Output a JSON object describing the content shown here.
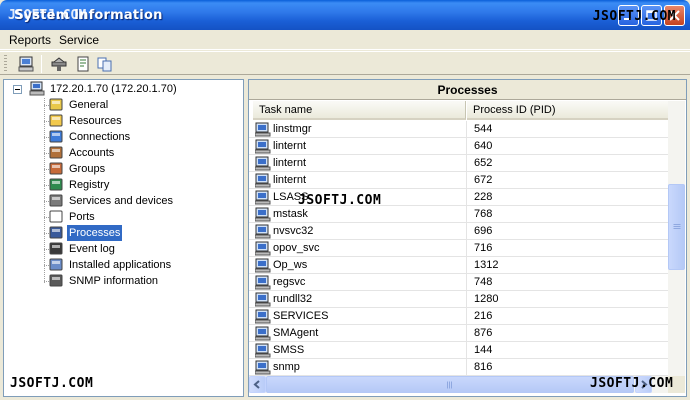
{
  "window": {
    "title": "System Information",
    "title_overlay": "JSOFTJ.COM",
    "watermark": "JSOFTJ.COM"
  },
  "menu": {
    "items": [
      {
        "label": "Reports"
      },
      {
        "label": "Service"
      }
    ]
  },
  "toolbar": {
    "buttons": [
      "computer-icon",
      "network-icon",
      "report-icon",
      "copy-icon"
    ]
  },
  "tree": {
    "root": "172.20.1.70 (172.20.1.70)",
    "items": [
      {
        "label": "General",
        "icon": "general-icon"
      },
      {
        "label": "Resources",
        "icon": "folder-icon"
      },
      {
        "label": "Connections",
        "icon": "connections-icon"
      },
      {
        "label": "Accounts",
        "icon": "accounts-icon"
      },
      {
        "label": "Groups",
        "icon": "groups-icon"
      },
      {
        "label": "Registry",
        "icon": "registry-icon"
      },
      {
        "label": "Services and devices",
        "icon": "services-icon"
      },
      {
        "label": "Ports",
        "icon": "ports-icon"
      },
      {
        "label": "Processes",
        "icon": "processes-icon",
        "selected": true
      },
      {
        "label": "Event log",
        "icon": "eventlog-icon"
      },
      {
        "label": "Installed applications",
        "icon": "installed-icon"
      },
      {
        "label": "SNMP information",
        "icon": "snmp-icon"
      }
    ]
  },
  "processes": {
    "title": "Processes",
    "columns": [
      "Task name",
      "Process ID (PID)"
    ],
    "rows": [
      {
        "name": "linstmgr",
        "pid": "544"
      },
      {
        "name": "linternt",
        "pid": "640"
      },
      {
        "name": "linternt",
        "pid": "652"
      },
      {
        "name": "linternt",
        "pid": "672"
      },
      {
        "name": "LSASS",
        "pid": "228"
      },
      {
        "name": "mstask",
        "pid": "768"
      },
      {
        "name": "nvsvc32",
        "pid": "696"
      },
      {
        "name": "opov_svc",
        "pid": "716"
      },
      {
        "name": "Op_ws",
        "pid": "1312"
      },
      {
        "name": "regsvc",
        "pid": "748"
      },
      {
        "name": "rundll32",
        "pid": "1280"
      },
      {
        "name": "SERVICES",
        "pid": "216"
      },
      {
        "name": "SMAgent",
        "pid": "876"
      },
      {
        "name": "SMSS",
        "pid": "144"
      },
      {
        "name": "snmp",
        "pid": "816"
      }
    ]
  }
}
